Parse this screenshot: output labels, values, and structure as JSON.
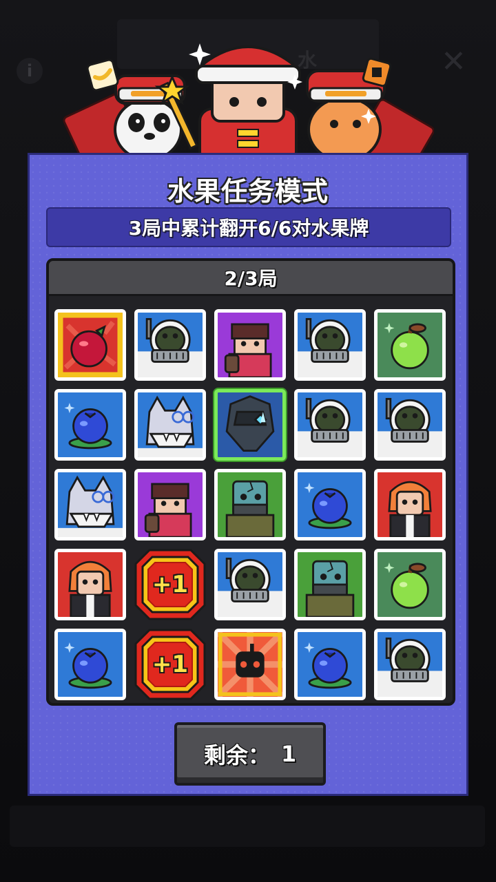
{
  "background": {
    "title_partial": "水",
    "info_glyph": "i",
    "close_glyph": "✕"
  },
  "panel": {
    "title": "水果任务模式",
    "subtitle": "3局中累计翻开6/6对水果牌",
    "round_label": "2/3局",
    "remaining_label": "剩余：",
    "remaining_value": "1"
  },
  "grid": {
    "rows": 5,
    "cols": 5,
    "cards": [
      {
        "type": "pomegranate"
      },
      {
        "type": "astronaut"
      },
      {
        "type": "girl"
      },
      {
        "type": "astronaut"
      },
      {
        "type": "apple"
      },
      {
        "type": "blueberry"
      },
      {
        "type": "wolf"
      },
      {
        "type": "crystal-armor",
        "selected": true
      },
      {
        "type": "astronaut"
      },
      {
        "type": "astronaut"
      },
      {
        "type": "wolf"
      },
      {
        "type": "girl"
      },
      {
        "type": "zombie"
      },
      {
        "type": "blueberry"
      },
      {
        "type": "redhead"
      },
      {
        "type": "redhead"
      },
      {
        "type": "plus-one"
      },
      {
        "type": "astronaut"
      },
      {
        "type": "zombie"
      },
      {
        "type": "apple"
      },
      {
        "type": "blueberry"
      },
      {
        "type": "plus-one"
      },
      {
        "type": "bomb-robot"
      },
      {
        "type": "blueberry"
      },
      {
        "type": "astronaut"
      }
    ],
    "bonus_text": "+1"
  },
  "colors": {
    "panel": "#6363d8",
    "subtitle_bar": "#3d3aa6",
    "board": "#222226",
    "selected_border": "#7bea5a"
  }
}
